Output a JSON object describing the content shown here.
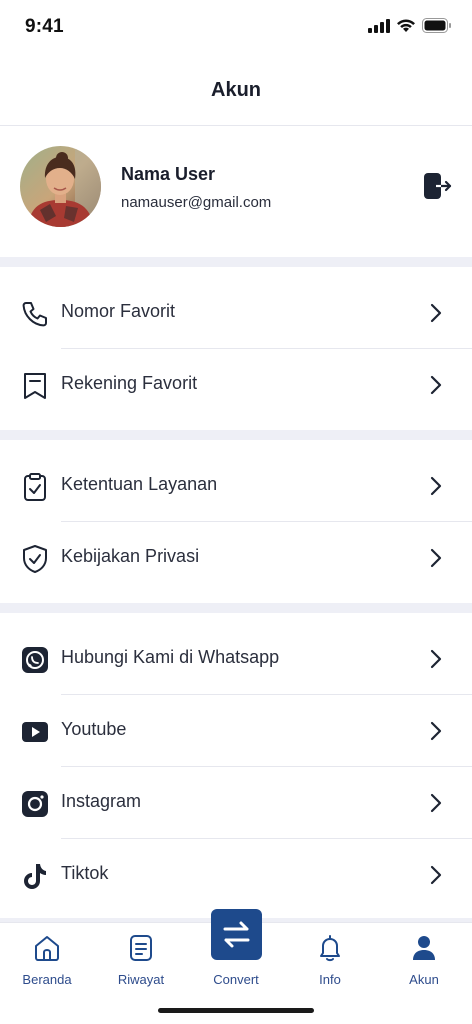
{
  "status_bar": {
    "time": "9:41"
  },
  "header": {
    "title": "Akun"
  },
  "profile": {
    "name": "Nama User",
    "email": "namauser@gmail.com"
  },
  "menu_groups": [
    {
      "items": [
        {
          "label": "Nomor Favorit",
          "icon": "phone-icon"
        },
        {
          "label": "Rekening Favorit",
          "icon": "bookmark-icon"
        }
      ]
    },
    {
      "items": [
        {
          "label": "Ketentuan Layanan",
          "icon": "clipboard-check-icon"
        },
        {
          "label": "Kebijakan Privasi",
          "icon": "shield-check-icon"
        }
      ]
    },
    {
      "items": [
        {
          "label": "Hubungi Kami di Whatsapp",
          "icon": "whatsapp-icon"
        },
        {
          "label": "Youtube",
          "icon": "youtube-icon"
        },
        {
          "label": "Instagram",
          "icon": "instagram-icon"
        },
        {
          "label": "Tiktok",
          "icon": "tiktok-icon"
        }
      ]
    }
  ],
  "bottom_nav": {
    "tabs": [
      {
        "label": "Beranda",
        "icon": "home-icon"
      },
      {
        "label": "Riwayat",
        "icon": "document-icon"
      },
      {
        "label": "Convert",
        "icon": "swap-icon"
      },
      {
        "label": "Info",
        "icon": "bell-icon"
      },
      {
        "label": "Akun",
        "icon": "user-icon",
        "active": true
      }
    ]
  },
  "colors": {
    "primary": "#1e4a8c",
    "text": "#1f2333",
    "separator": "#eeeff6",
    "icon": "#1d2433"
  }
}
